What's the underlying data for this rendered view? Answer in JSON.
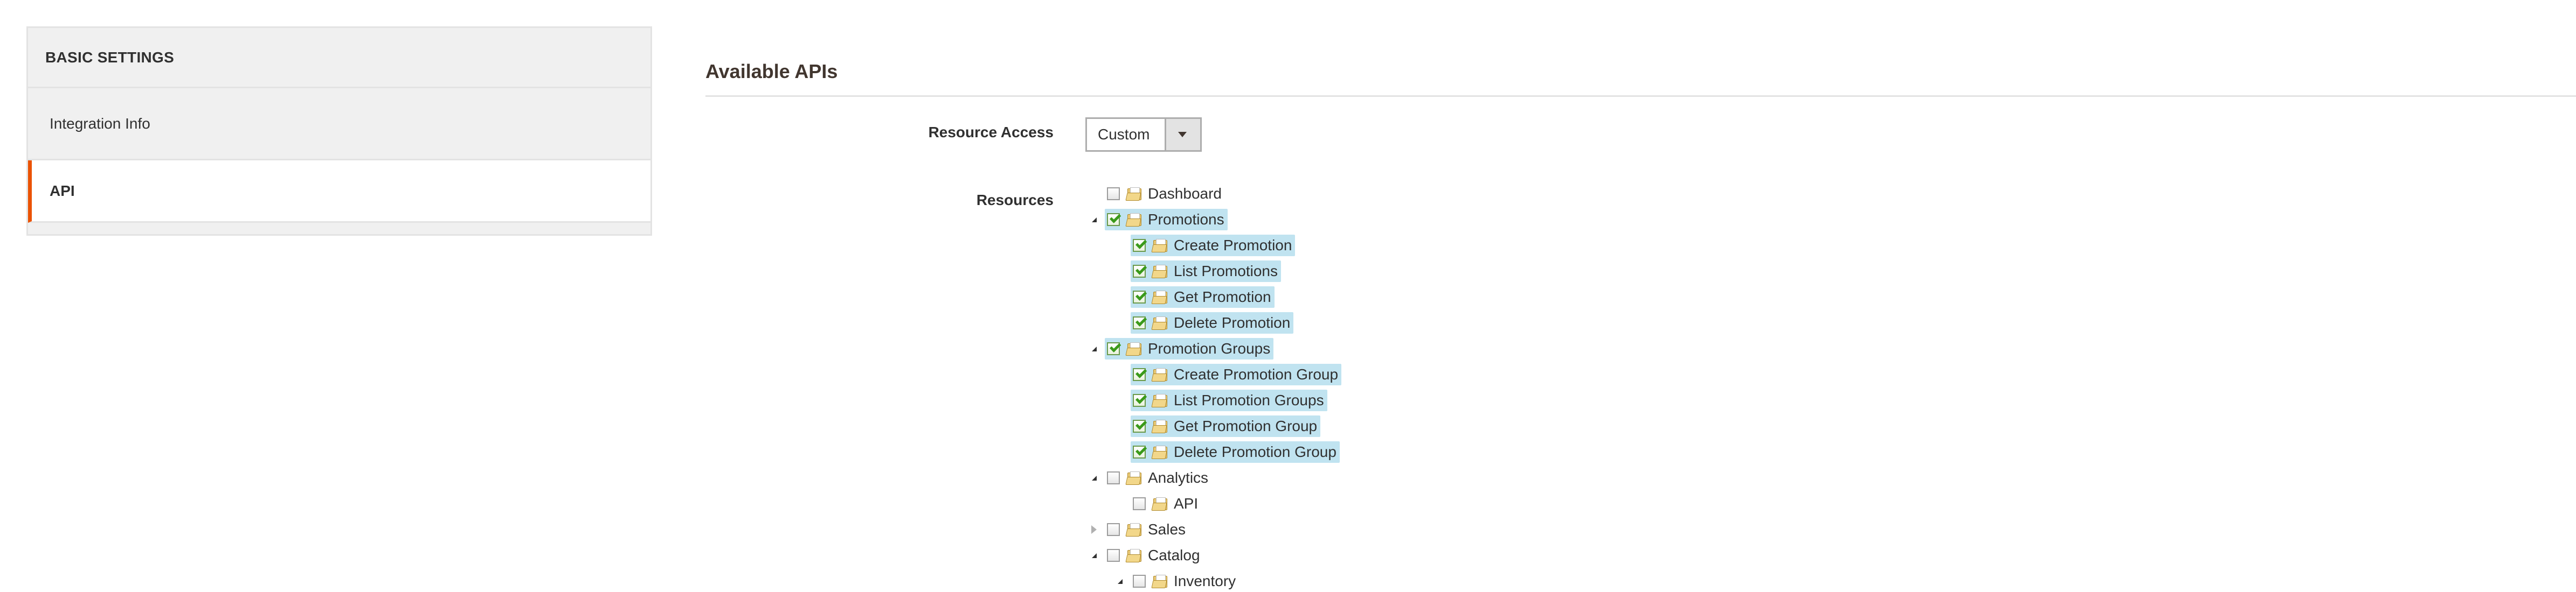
{
  "sidebar": {
    "header": "BASIC SETTINGS",
    "items": [
      {
        "label": "Integration Info",
        "active": false
      },
      {
        "label": "API",
        "active": true
      }
    ]
  },
  "main": {
    "title": "Available APIs",
    "resource_access": {
      "label": "Resource Access",
      "value": "Custom"
    },
    "resources": {
      "label": "Resources",
      "tree": [
        {
          "label": "Dashboard",
          "checked": false,
          "toggle": "none",
          "level": 0
        },
        {
          "label": "Promotions",
          "checked": true,
          "toggle": "open",
          "level": 0
        },
        {
          "label": "Create Promotion",
          "checked": true,
          "toggle": "none",
          "level": 1
        },
        {
          "label": "List Promotions",
          "checked": true,
          "toggle": "none",
          "level": 1
        },
        {
          "label": "Get Promotion",
          "checked": true,
          "toggle": "none",
          "level": 1
        },
        {
          "label": "Delete Promotion",
          "checked": true,
          "toggle": "none",
          "level": 1
        },
        {
          "label": "Promotion Groups",
          "checked": true,
          "toggle": "open",
          "level": 0
        },
        {
          "label": "Create Promotion Group",
          "checked": true,
          "toggle": "none",
          "level": 1
        },
        {
          "label": "List Promotion Groups",
          "checked": true,
          "toggle": "none",
          "level": 1
        },
        {
          "label": "Get Promotion Group",
          "checked": true,
          "toggle": "none",
          "level": 1
        },
        {
          "label": "Delete Promotion Group",
          "checked": true,
          "toggle": "none",
          "level": 1
        },
        {
          "label": "Analytics",
          "checked": false,
          "toggle": "open",
          "level": 0
        },
        {
          "label": "API",
          "checked": false,
          "toggle": "none",
          "level": 1
        },
        {
          "label": "Sales",
          "checked": false,
          "toggle": "closed",
          "level": 0
        },
        {
          "label": "Catalog",
          "checked": false,
          "toggle": "open",
          "level": 0
        },
        {
          "label": "Inventory",
          "checked": false,
          "toggle": "open",
          "level": 1
        }
      ]
    }
  },
  "colors": {
    "accent": "#eb5202",
    "selected_bg": "#c0e3f0",
    "check_green": "#3a9a1a"
  }
}
